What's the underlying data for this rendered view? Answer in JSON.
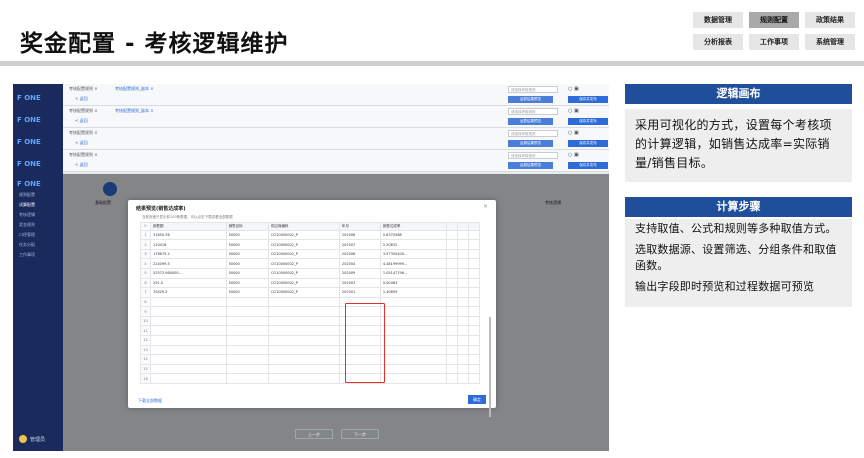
{
  "header": {
    "title": "奖金配置 - 考核逻辑维护",
    "nav": [
      "数据管理",
      "规则配置",
      "政策结果",
      "分析报表",
      "工作事项",
      "系统管理"
    ],
    "active_nav": "规则配置"
  },
  "app": {
    "logo": "F ONE",
    "sidebar_items": [
      "规则配置",
      "试算配置",
      "考核逻辑",
      "奖金规则",
      "口径管理",
      "任务分配",
      "工作事项"
    ],
    "sidebar_user": "管理员",
    "sheet_tab": "考核配置规则 ×",
    "sheet_tab2": "考核配置规则_副本 ×",
    "back_label": "< 返回",
    "search_placeholder": "请选择考核规则",
    "btn_preview": "运算结果预览",
    "btn_save": "保存并发布",
    "step_labels": [
      "基础配置",
      "考核逻辑"
    ],
    "bottom_buttons": [
      "上一步",
      "下一步"
    ]
  },
  "dialog": {
    "title": "结果预览(销售达成率)",
    "subtitle": "当前页面只显示前100条数据，可以点击下载查看全部数据",
    "columns": [
      "销售额",
      "销售目标",
      "供应商编码",
      "年月",
      "销售达成率"
    ],
    "rows": [
      [
        "31850.56",
        "50000",
        "CO10000002_P",
        "202006",
        "0.6370588"
      ],
      [
        "110416",
        "50000",
        "CO10000002_P",
        "202007",
        "2.20832"
      ],
      [
        "178675.2",
        "50000",
        "CO10000002_P",
        "202008",
        "3.57350400..."
      ],
      [
        "224099.5",
        "50000",
        "CO10000002_P",
        "202004",
        "4.48199999..."
      ],
      [
        "52573.980000...",
        "50000",
        "CO10000002_P",
        "202009",
        "1.05147796..."
      ],
      [
        "291.5",
        "50000",
        "CO10000002_P",
        "202003",
        "0.00463"
      ],
      [
        "70429.5",
        "50000",
        "CO10000002_P",
        "202001",
        "1.40859"
      ]
    ],
    "row_numbers": [
      "1",
      "2",
      "3",
      "4",
      "5",
      "6",
      "7",
      "8",
      "9",
      "10",
      "11",
      "12",
      "13",
      "14",
      "15",
      "16"
    ],
    "download_label": "下载全部数据",
    "ok_label": "确定"
  },
  "panels": {
    "logic_title": "逻辑画布",
    "logic_text": "采用可视化的方式，设置每个考核项的计算逻辑，如销售达成率=实际销量/销售目标。",
    "steps_title": "计算步骤",
    "steps_lines": [
      "支持取值、公式和规则等多种取值方式。",
      "选取数据源、设置筛选、分组条件和取值函数。",
      "输出字段即时预览和过程数据可预览"
    ]
  }
}
